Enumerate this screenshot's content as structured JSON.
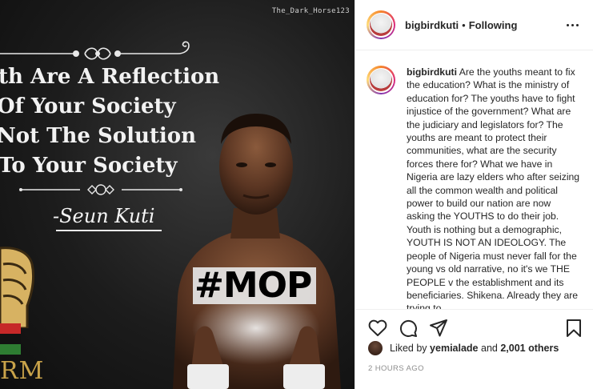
{
  "image": {
    "watermark": "The_Dark_Horse123",
    "quote_lines": [
      "th Are A Reflection",
      "Of Your Society",
      "Not The Solution",
      "To Your Society"
    ],
    "signature": "-Seun Kuti",
    "hashtag": "#MOP",
    "corner_letters": "RM"
  },
  "header": {
    "username": "bigbirdkuti",
    "separator": "•",
    "follow_status": "Following"
  },
  "caption": {
    "username": "bigbirdkuti",
    "text": "Are the youths meant to fix the education? What is the ministry of education for? The youths have to fight injustice of the government? What are the judiciary and legislators for? The youths are meant to protect their communities, what are the security forces there for? What we have in Nigeria are lazy elders who after seizing all the common wealth and political power to build our nation are now asking the YOUTHS to do their job. Youth is nothing but a demographic, YOUTH IS NOT AN IDEOLOGY. The people of Nigeria must never fall for the young vs old narrative, no it's we THE PEOPLE v the establishment and its beneficiaries. Shikena. Already they are trying to"
  },
  "actions": {
    "like_icon": "heart-icon",
    "comment_icon": "comment-icon",
    "share_icon": "share-icon",
    "save_icon": "bookmark-icon"
  },
  "likes": {
    "prefix": "Liked by",
    "by_user": "yemialade",
    "joiner": "and",
    "others": "2,001 others"
  },
  "timestamp": "2 HOURS AGO",
  "colors": {
    "text": "#262626",
    "muted": "#8e8e8e",
    "border": "#efefef"
  }
}
